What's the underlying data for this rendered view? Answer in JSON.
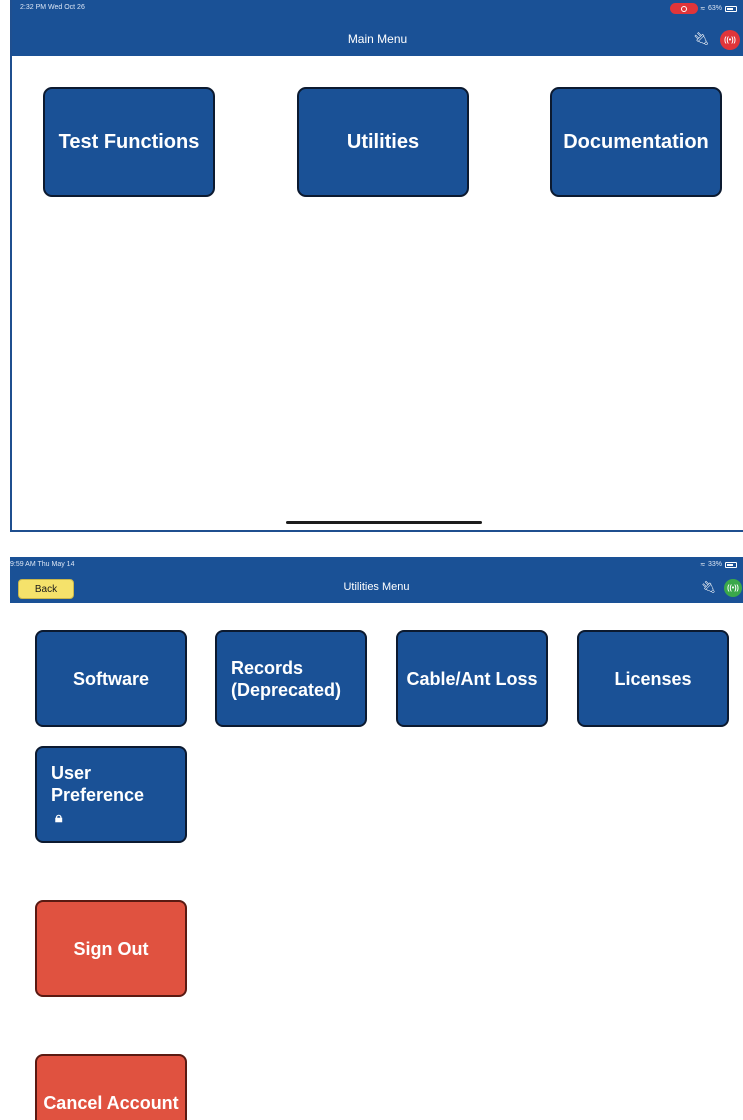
{
  "main_menu": {
    "status_time": "2:32 PM  Wed Oct 26",
    "status_battery": "63%",
    "title": "Main Menu",
    "plug_icon": "plug-icon",
    "signal_icon": "broadcast-icon",
    "signal_color": "#e0353a",
    "buttons": {
      "test_functions": "Test Functions",
      "utilities": "Utilities",
      "documentation": "Documentation"
    }
  },
  "utilities_menu": {
    "status_time": "9:59 AM  Thu May 14",
    "status_battery": "33%",
    "title": "Utilities Menu",
    "back_label": "Back",
    "signal_color": "#3aa84a",
    "buttons": {
      "software": "Software",
      "records": "Records (Deprecated)",
      "cable_ant_loss": "Cable/Ant Loss",
      "licenses": "Licenses",
      "user_preference": "User Preference",
      "sign_out": "Sign Out",
      "cancel_account": "Cancel Account"
    }
  },
  "colors": {
    "header_blue": "#1a5196",
    "button_blue": "#1a5196",
    "button_red": "#e05240",
    "back_yellow": "#f5e26b"
  },
  "icons": {
    "lock": "lock-icon",
    "wifi": "wifi-icon",
    "battery": "battery-icon"
  }
}
